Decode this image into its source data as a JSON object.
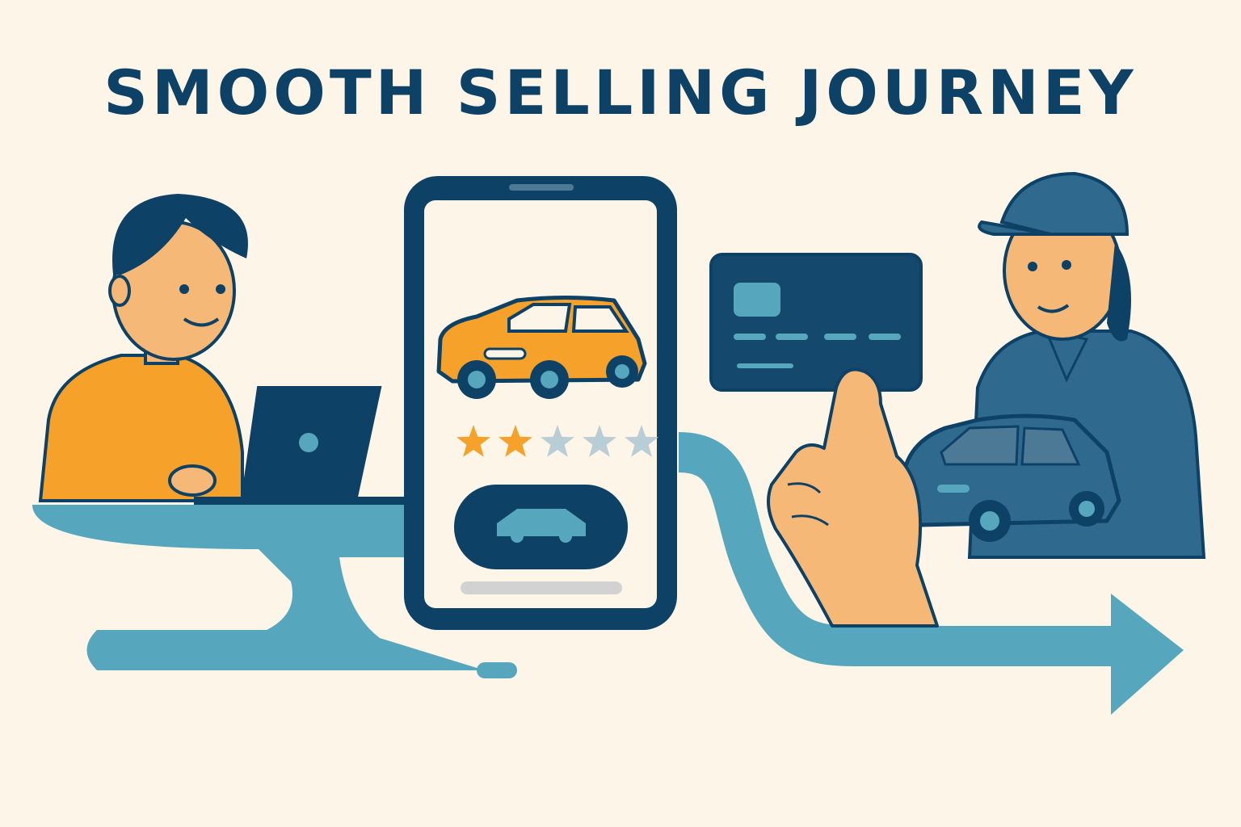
{
  "title": "SMOOTH SELLING JOURNEY",
  "rating": {
    "value": 2,
    "max": 5
  },
  "colors": {
    "background": "#fdf6e8",
    "navy": "#0d4166",
    "teal": "#56a7bd",
    "orange": "#f6a12a",
    "skin": "#f5b877",
    "star_empty": "#b9cdd6"
  },
  "icons": [
    "laptop-icon",
    "smartphone-icon",
    "orange-car-icon",
    "star-icon",
    "car-button-icon",
    "credit-card-icon",
    "blue-car-icon",
    "journey-arrow-icon"
  ]
}
